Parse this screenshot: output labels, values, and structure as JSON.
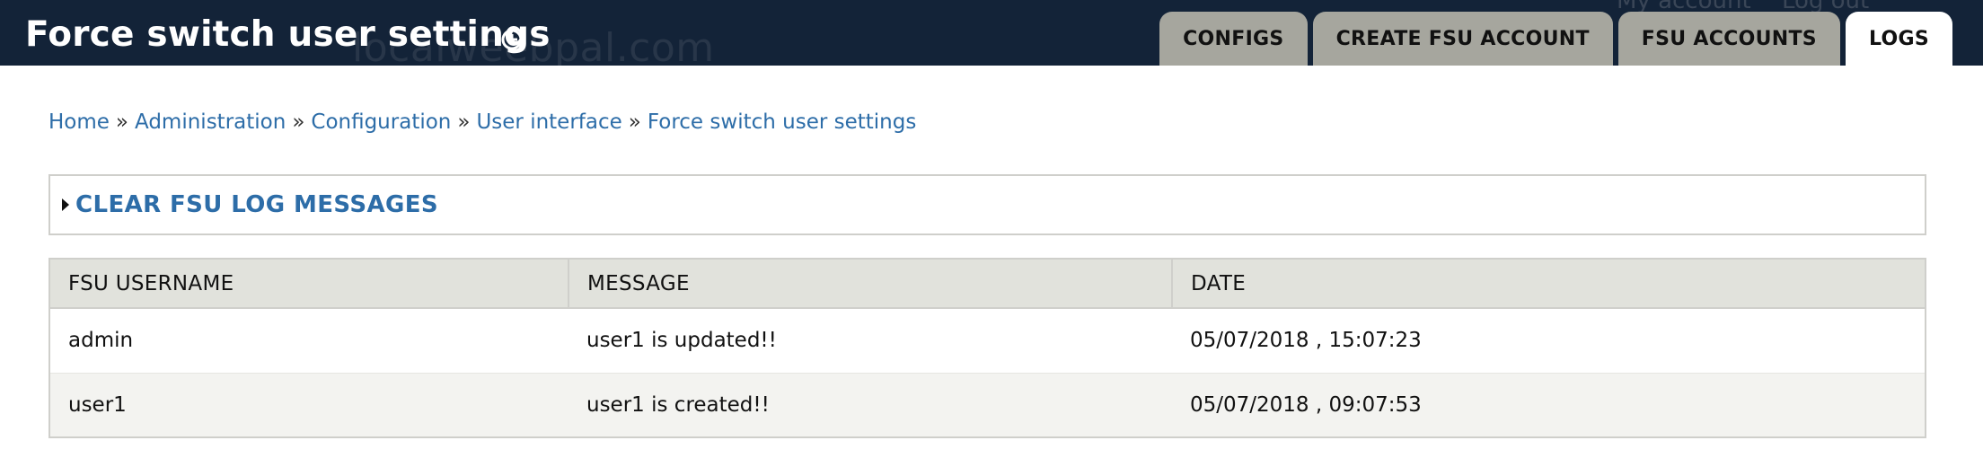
{
  "header": {
    "title": "Force switch user settings",
    "watermark": "localweebpal.com",
    "secondary_links": [
      "My account",
      "Log out"
    ]
  },
  "tabs": [
    {
      "label": "CONFIGS",
      "active": false
    },
    {
      "label": "CREATE FSU ACCOUNT",
      "active": false
    },
    {
      "label": "FSU ACCOUNTS",
      "active": false
    },
    {
      "label": "LOGS",
      "active": true
    }
  ],
  "breadcrumb": {
    "items": [
      "Home",
      "Administration",
      "Configuration",
      "User interface",
      "Force switch user settings"
    ],
    "separator": "»"
  },
  "fieldset": {
    "title": "CLEAR FSU LOG MESSAGES"
  },
  "table": {
    "headers": [
      "FSU USERNAME",
      "MESSAGE",
      "DATE"
    ],
    "rows": [
      [
        "admin",
        "user1 is updated!!",
        "05/07/2018 , 15:07:23"
      ],
      [
        "user1",
        "user1 is created!!",
        "05/07/2018 , 09:07:53"
      ]
    ]
  },
  "colors": {
    "header_bg": "#132338",
    "tab_bg": "#a6a69e",
    "link": "#2d6da8",
    "table_header_bg": "#e1e2dc"
  },
  "icons": {
    "shortcut": "plus-circle-icon",
    "collapse": "triangle-right-icon"
  }
}
